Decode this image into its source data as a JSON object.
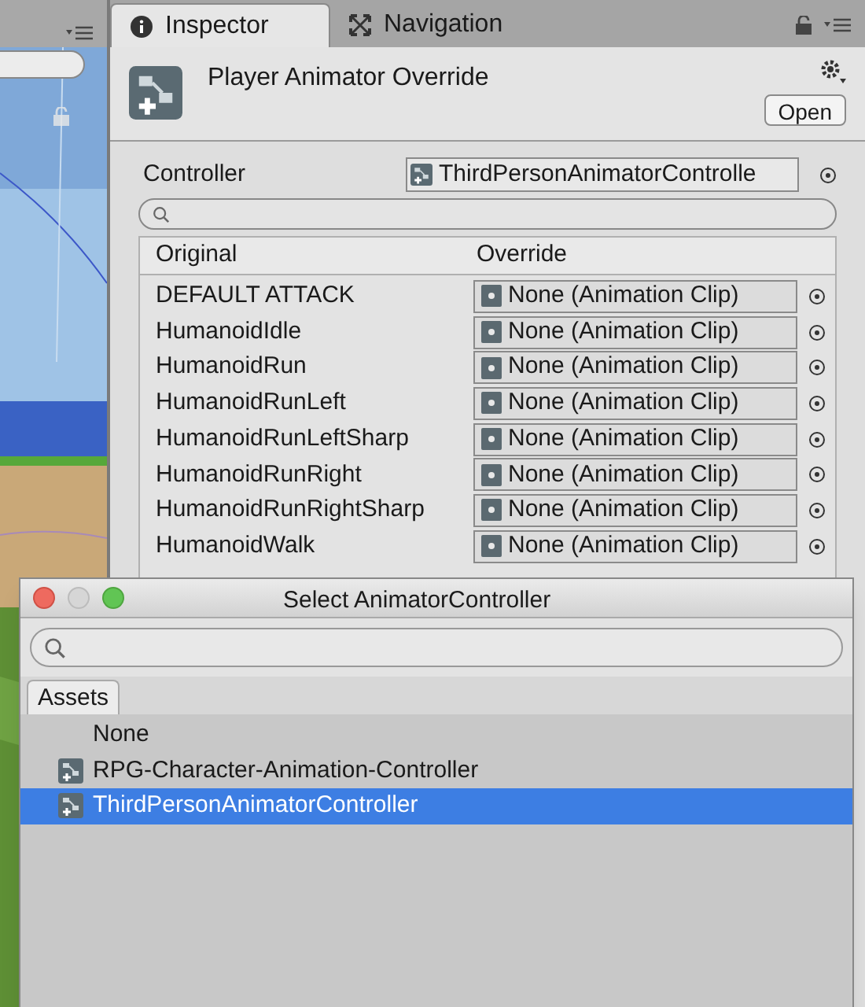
{
  "tabs": [
    {
      "label": "Inspector",
      "selected": true
    },
    {
      "label": "Navigation",
      "selected": false
    }
  ],
  "header": {
    "title": "Player Animator Override",
    "open_button": "Open"
  },
  "controller": {
    "label": "Controller",
    "value": "ThirdPersonAnimatorControlle"
  },
  "table": {
    "columns": [
      "Original",
      "Override"
    ],
    "rows": [
      {
        "original": "DEFAULT ATTACK",
        "override": "None (Animation Clip)"
      },
      {
        "original": "HumanoidIdle",
        "override": "None (Animation Clip)"
      },
      {
        "original": "HumanoidRun",
        "override": "None (Animation Clip)"
      },
      {
        "original": "HumanoidRunLeft",
        "override": "None (Animation Clip)"
      },
      {
        "original": "HumanoidRunLeftSharp",
        "override": "None (Animation Clip)"
      },
      {
        "original": "HumanoidRunRight",
        "override": "None (Animation Clip)"
      },
      {
        "original": "HumanoidRunRightSharp",
        "override": "None (Animation Clip)"
      },
      {
        "original": "HumanoidWalk",
        "override": "None (Animation Clip)"
      }
    ]
  },
  "dialog": {
    "title": "Select AnimatorController",
    "tabs": [
      {
        "label": "Assets",
        "selected": true
      }
    ],
    "items": [
      {
        "label": "None",
        "kind": "none",
        "selected": false
      },
      {
        "label": "RPG-Character-Animation-Controller",
        "kind": "controller",
        "selected": false
      },
      {
        "label": "ThirdPersonAnimatorController",
        "kind": "controller",
        "selected": true
      }
    ]
  }
}
